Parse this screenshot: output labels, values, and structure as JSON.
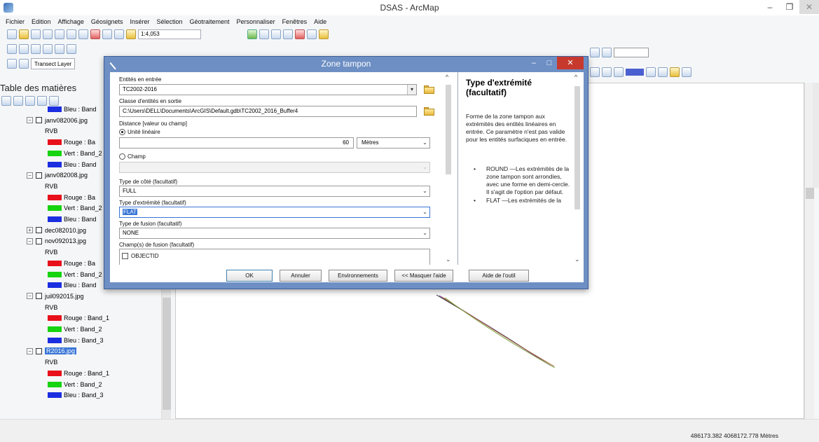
{
  "app": {
    "title": "DSAS - ArcMap"
  },
  "menu": [
    "Fichier",
    "Edition",
    "Affichage",
    "Géosignets",
    "Insérer",
    "Sélection",
    "Géotraitement",
    "Personnaliser",
    "Fenêtres",
    "Aide"
  ],
  "toolbar": {
    "scale": "1:4,053",
    "layer_combo": "Transect Layer"
  },
  "toc": {
    "title": "Table des matières",
    "rows": [
      {
        "type": "band",
        "color": "b",
        "label": "Bleu : Band"
      },
      {
        "type": "layer",
        "label": "janv082006.jpg"
      },
      {
        "type": "rvb",
        "label": "RVB"
      },
      {
        "type": "band",
        "color": "r",
        "label": "Rouge : Ba"
      },
      {
        "type": "band",
        "color": "g",
        "label": "Vert : Band_2"
      },
      {
        "type": "band",
        "color": "b",
        "label": "Bleu : Band"
      },
      {
        "type": "layer",
        "label": "janv082008.jpg"
      },
      {
        "type": "rvb",
        "label": "RVB"
      },
      {
        "type": "band",
        "color": "r",
        "label": "Rouge : Ba"
      },
      {
        "type": "band",
        "color": "g",
        "label": "Vert : Band_2"
      },
      {
        "type": "band",
        "color": "b",
        "label": "Bleu : Band"
      },
      {
        "type": "layer-collapsed",
        "label": "dec082010.jpg"
      },
      {
        "type": "layer",
        "label": "nov092013.jpg"
      },
      {
        "type": "rvb",
        "label": "RVB"
      },
      {
        "type": "band",
        "color": "r",
        "label": "Rouge : Ba"
      },
      {
        "type": "band",
        "color": "g",
        "label": "Vert : Band_2"
      },
      {
        "type": "band",
        "color": "b",
        "label": "Bleu : Band"
      },
      {
        "type": "layer",
        "label": "juil092015.jpg"
      },
      {
        "type": "rvb",
        "label": "RVB"
      },
      {
        "type": "band",
        "color": "r",
        "label": "Rouge : Band_1"
      },
      {
        "type": "band",
        "color": "g",
        "label": "Vert : Band_2"
      },
      {
        "type": "band",
        "color": "b",
        "label": "Bleu : Band_3"
      },
      {
        "type": "layer-selected",
        "label": "R2016.jpg"
      },
      {
        "type": "rvb",
        "label": "RVB"
      },
      {
        "type": "band",
        "color": "r",
        "label": "Rouge : Band_1"
      },
      {
        "type": "band",
        "color": "g",
        "label": "Vert : Band_2"
      },
      {
        "type": "band",
        "color": "b",
        "label": "Bleu : Band_3"
      }
    ]
  },
  "status": {
    "coords": "486173.382  4068172.778 Mètres"
  },
  "dialog": {
    "title": "Zone tampon",
    "input_label": "Entités en entrée",
    "input_value": "TC2002-2016",
    "output_label": "Classe d'entités en sortie",
    "output_value": "C:\\Users\\DELL\\Documents\\ArcGIS\\Default.gdb\\TC2002_2016_Buffer4",
    "distance_label": "Distance [valeur ou champ]",
    "linear_label": "Unité linéaire",
    "distance_value": "60",
    "units_value": "Mètres",
    "field_label": "Champ",
    "side_label": "Type de côté (facultatif)",
    "side_value": "FULL",
    "end_label": "Type d'extrémité (facultatif)",
    "end_value": "FLAT",
    "dissolve_label": "Type de fusion (facultatif)",
    "dissolve_value": "NONE",
    "fields_label": "Champ(s) de fusion (facultatif)",
    "field_item": "OBJECTID",
    "buttons": {
      "ok": "OK",
      "cancel": "Annuler",
      "env": "Environnements",
      "hide_help": "<< Masquer l'aide",
      "tool_help": "Aide de l'outil"
    },
    "help": {
      "title": "Type d'extrémité (facultatif)",
      "text": "Forme de la zone tampon aux extrémités des entités linéaires en entrée. Ce paramètre n'est pas valide pour les entités surfaciques en entrée.",
      "items": [
        "ROUND —Les extrémités de la zone tampon sont arrondies, avec une forme en demi-cercle. Il s'agit de l'option par défaut.",
        "FLAT —Les extrémités de la"
      ]
    }
  }
}
